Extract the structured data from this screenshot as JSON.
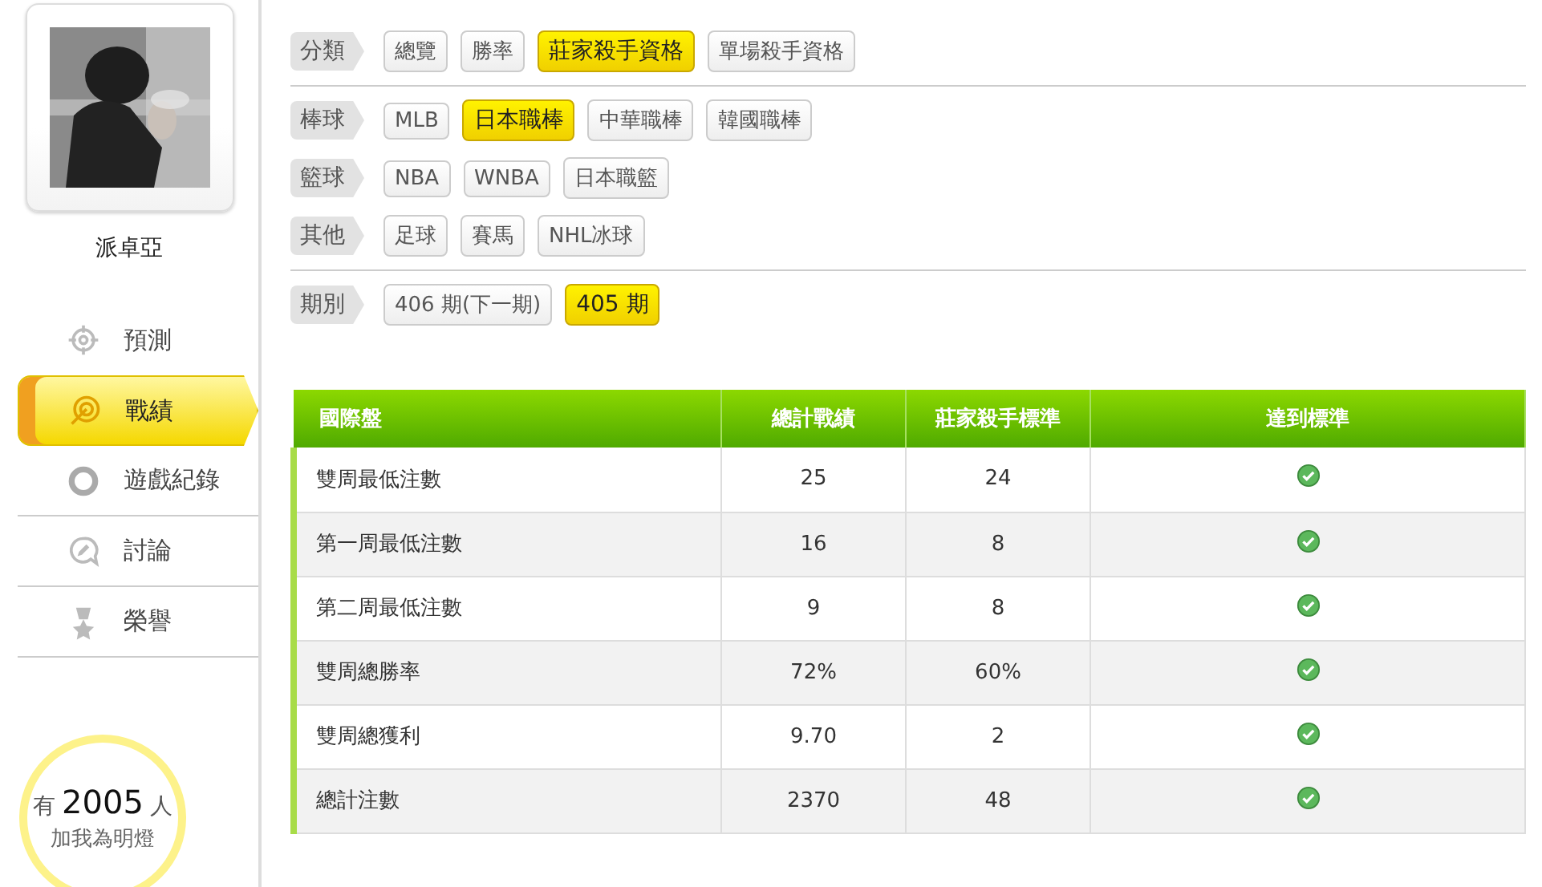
{
  "profile": {
    "name": "派卓亞"
  },
  "nav": [
    {
      "label": "預測",
      "kind": "crosshair",
      "selected": false
    },
    {
      "label": "戰績",
      "kind": "target",
      "selected": true
    },
    {
      "label": "遊戲紀錄",
      "kind": "ring",
      "selected": false
    },
    {
      "label": "討論",
      "kind": "chat",
      "selected": false
    },
    {
      "label": "榮譽",
      "kind": "medal",
      "selected": false
    }
  ],
  "fans": {
    "prefix": "有",
    "count": "2005",
    "suffix": "人",
    "caption": "加我為明燈"
  },
  "filter_sections": [
    [
      {
        "label": "分類",
        "options": [
          {
            "label": "總覽",
            "selected": false
          },
          {
            "label": "勝率",
            "selected": false
          },
          {
            "label": "莊家殺手資格",
            "selected": true
          },
          {
            "label": "單場殺手資格",
            "selected": false
          }
        ]
      }
    ],
    [
      {
        "label": "棒球",
        "options": [
          {
            "label": "MLB",
            "selected": false
          },
          {
            "label": "日本職棒",
            "selected": true
          },
          {
            "label": "中華職棒",
            "selected": false
          },
          {
            "label": "韓國職棒",
            "selected": false
          }
        ]
      },
      {
        "label": "籃球",
        "options": [
          {
            "label": "NBA",
            "selected": false
          },
          {
            "label": "WNBA",
            "selected": false
          },
          {
            "label": "日本職籃",
            "selected": false
          }
        ]
      },
      {
        "label": "其他",
        "options": [
          {
            "label": "足球",
            "selected": false
          },
          {
            "label": "賽馬",
            "selected": false
          },
          {
            "label": "NHL冰球",
            "selected": false
          }
        ]
      }
    ],
    [
      {
        "label": "期別",
        "options": [
          {
            "label": "406 期(下一期)",
            "selected": false
          },
          {
            "label": "405 期",
            "selected": true
          }
        ]
      }
    ]
  ],
  "table": {
    "columns": [
      "國際盤",
      "總計戰績",
      "莊家殺手標準",
      "達到標準"
    ],
    "rows": [
      {
        "name": "雙周最低注數",
        "total": "25",
        "standard": "24",
        "met": true
      },
      {
        "name": "第一周最低注數",
        "total": "16",
        "standard": "8",
        "met": true
      },
      {
        "name": "第二周最低注數",
        "total": "9",
        "standard": "8",
        "met": true
      },
      {
        "name": "雙周總勝率",
        "total": "72%",
        "standard": "60%",
        "met": true
      },
      {
        "name": "雙周總獲利",
        "total": "9.70",
        "standard": "2",
        "met": true
      },
      {
        "name": "總計注數",
        "total": "2370",
        "standard": "48",
        "met": true
      }
    ]
  }
}
